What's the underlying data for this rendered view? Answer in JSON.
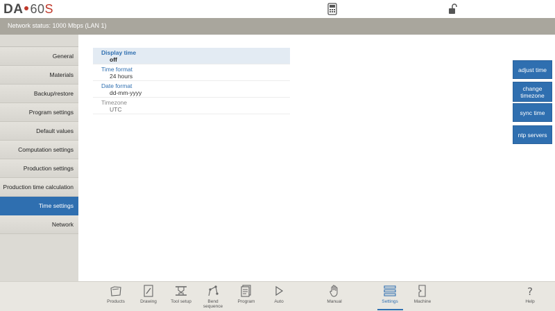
{
  "header": {
    "logo_prefix": "DA",
    "logo_model": "60",
    "logo_suffix": "S",
    "accent_color": "#c0392b",
    "icons": [
      "calculator-icon",
      "unlocked-padlock-icon"
    ]
  },
  "status": {
    "text": "Network status: 1000 Mbps (LAN 1)"
  },
  "sidebar": {
    "items": [
      {
        "label": "General"
      },
      {
        "label": "Materials"
      },
      {
        "label": "Backup/restore"
      },
      {
        "label": "Program settings"
      },
      {
        "label": "Default values"
      },
      {
        "label": "Computation settings"
      },
      {
        "label": "Production settings"
      },
      {
        "label": "Production time calculation"
      },
      {
        "label": "Time settings",
        "active": true
      },
      {
        "label": "Network"
      }
    ]
  },
  "settings": [
    {
      "label": "Display time",
      "value": "off"
    },
    {
      "label": "Time format",
      "value": "24 hours"
    },
    {
      "label": "Date format",
      "value": "dd-mm-yyyy"
    },
    {
      "label": "Timezone",
      "value": "UTC"
    }
  ],
  "actions": [
    {
      "label": "adjust time"
    },
    {
      "label": "change timezone"
    },
    {
      "label": "sync time"
    },
    {
      "label": "ntp servers"
    }
  ],
  "toolbar": {
    "items": [
      {
        "label": "Products",
        "icon": "products-icon"
      },
      {
        "label": "Drawing",
        "icon": "drawing-icon"
      },
      {
        "label": "Tool setup",
        "icon": "tool-setup-icon"
      },
      {
        "label": "Bend sequence",
        "icon": "bend-sequence-icon"
      },
      {
        "label": "Program",
        "icon": "program-icon"
      },
      {
        "label": "Auto",
        "icon": "play-icon"
      },
      {
        "label": "Manual",
        "icon": "hand-icon"
      },
      {
        "label": "Settings",
        "icon": "settings-list-icon",
        "active": true
      },
      {
        "label": "Machine",
        "icon": "machine-icon"
      },
      {
        "label": "Help",
        "icon": "help-icon"
      }
    ]
  },
  "colors": {
    "primary": "#2f6fb0",
    "status_bar": "#a9a69d",
    "sidebar_bg": "#dcdad4"
  }
}
